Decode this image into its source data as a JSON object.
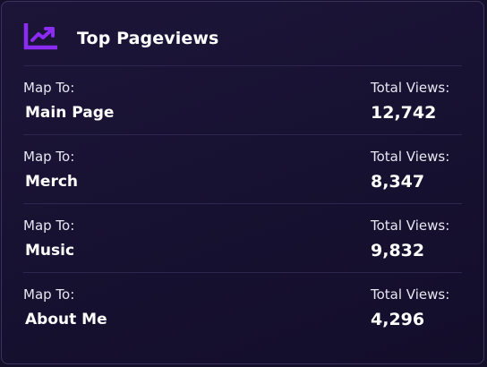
{
  "widget": {
    "title": "Top Pageviews",
    "icon": "trending-up-chart-icon",
    "accent_color": "#8b2cf5",
    "map_label": "Map To:",
    "views_label": "Total Views:",
    "rows": [
      {
        "page": "Main Page",
        "views": "12,742"
      },
      {
        "page": "Merch",
        "views": "8,347"
      },
      {
        "page": "Music",
        "views": "9,832"
      },
      {
        "page": "About Me",
        "views": "4,296"
      }
    ]
  }
}
